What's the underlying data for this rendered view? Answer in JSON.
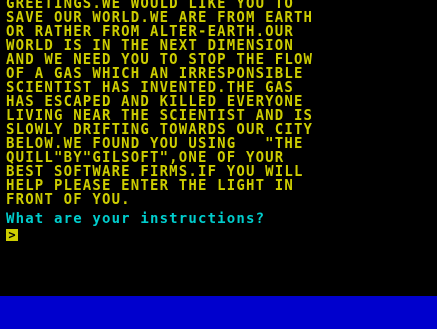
{
  "colors": {
    "background": "#000000",
    "story_text": "#cdcd00",
    "prompt_text": "#00cdcd",
    "cursor": "#cdcd00",
    "border": "#0000cd"
  },
  "story": {
    "lines": [
      "GREETINGS.WE WOULD LIKE YOU TO",
      "SAVE OUR WORLD.WE ARE FROM EARTH",
      "OR RATHER FROM ALTER-EARTH.OUR",
      "WORLD IS IN THE NEXT DIMENSION",
      "AND WE NEED YOU TO STOP THE FLOW",
      "OF A GAS WHICH AN IRRESPONSIBLE",
      "SCIENTIST HAS INVENTED.THE GAS",
      "HAS ESCAPED AND KILLED EVERYONE",
      "LIVING NEAR THE SCIENTIST AND IS",
      "SLOWLY DRIFTING TOWARDS OUR CITY",
      "BELOW.WE FOUND YOU USING   \"THE",
      "QUILL\"BY\"GILSOFT\",ONE OF YOUR",
      "BEST SOFTWARE FIRMS.IF YOU WILL",
      "HELP PLEASE ENTER THE LIGHT IN",
      "FRONT OF YOU."
    ]
  },
  "prompt": {
    "question": "What are your instructions?",
    "cursor_glyph": ">"
  }
}
